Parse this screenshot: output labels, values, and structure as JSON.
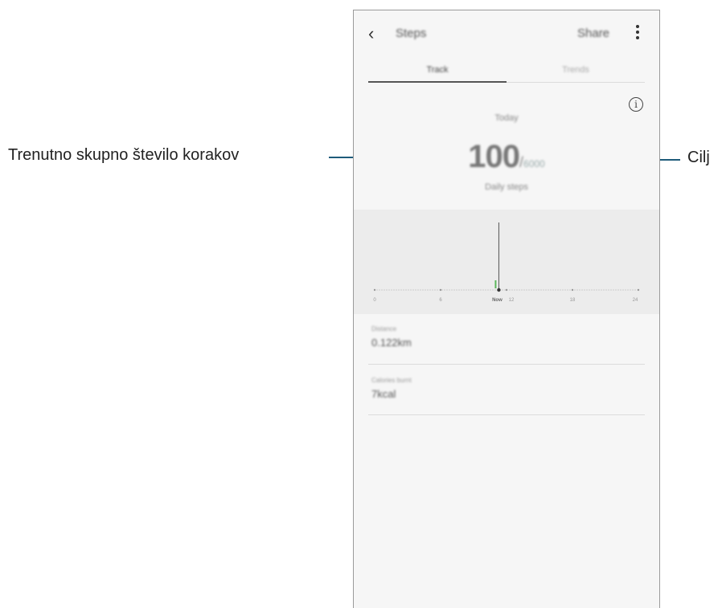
{
  "callouts": {
    "left_label": "Trenutno skupno število korakov",
    "right_label": "Cilj"
  },
  "app": {
    "title": "Steps",
    "back_icon": "‹",
    "share_label": "Share",
    "menu_icon": "more-vertical-icon"
  },
  "tabs": [
    {
      "label": "Track",
      "active": true
    },
    {
      "label": "Trends",
      "active": false
    }
  ],
  "info_icon_glyph": "i",
  "summary": {
    "day": "Today",
    "current_steps": "100",
    "separator": "/",
    "goal_steps": "6000",
    "caption": "Daily steps"
  },
  "chart_data": {
    "type": "bar",
    "x_tick_labels": [
      "0",
      "6",
      "Now",
      "12",
      "18",
      "24"
    ],
    "current_marker": "Now",
    "bars": [
      {
        "hour": 12,
        "level": "small",
        "color": "#5cb85c"
      }
    ],
    "colors": {
      "bar": "#5cb85c",
      "marker": "#333333",
      "axis_dots": "#999999",
      "background": "#ececec"
    }
  },
  "details": [
    {
      "label": "Distance",
      "value": "0.122km"
    },
    {
      "label": "Calories burnt",
      "value": "7kcal"
    }
  ]
}
